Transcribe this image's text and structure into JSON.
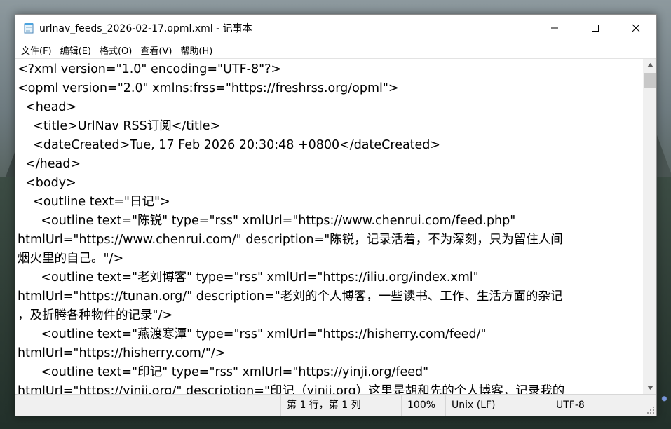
{
  "window": {
    "title": "urlnav_feeds_2026-02-17.opml.xml - 记事本",
    "minimize_glyph": "─",
    "maximize_glyph": "☐",
    "close_glyph": "✕"
  },
  "menubar": {
    "items": [
      {
        "label": "文件(F)"
      },
      {
        "label": "编辑(E)"
      },
      {
        "label": "格式(O)"
      },
      {
        "label": "查看(V)"
      },
      {
        "label": "帮助(H)"
      }
    ]
  },
  "document": {
    "lines": [
      "<?xml version=\"1.0\" encoding=\"UTF-8\"?>",
      "<opml version=\"2.0\" xmlns:frss=\"https://freshrss.org/opml\">",
      "  <head>",
      "    <title>UrlNav RSS订阅</title>",
      "    <dateCreated>Tue, 17 Feb 2026 20:30:48 +0800</dateCreated>",
      "  </head>",
      "  <body>",
      "    <outline text=\"日记\">",
      "      <outline text=\"陈锐\" type=\"rss\" xmlUrl=\"https://www.chenrui.com/feed.php\"",
      "htmlUrl=\"https://www.chenrui.com/\" description=\"陈锐，记录活着，不为深刻，只为留住人间",
      "烟火里的自己。\"/>",
      "      <outline text=\"老刘博客\" type=\"rss\" xmlUrl=\"https://iliu.org/index.xml\"",
      "htmlUrl=\"https://tunan.org/\" description=\"老刘的个人博客，一些读书、工作、生活方面的杂记",
      "，及折腾各种物件的记录\"/>",
      "      <outline text=\"燕渡寒潭\" type=\"rss\" xmlUrl=\"https://hisherry.com/feed/\"",
      "htmlUrl=\"https://hisherry.com/\"/>",
      "      <outline text=\"印记\" type=\"rss\" xmlUrl=\"https://yinji.org/feed\"",
      "htmlUrl=\"https://yinji.org/\" description=\"印记（yinji.org）这里是胡和先的个人博客，记录我的"
    ]
  },
  "statusbar": {
    "position": "第 1 行，第 1 列",
    "zoom": "100%",
    "line_ending": "Unix (LF)",
    "encoding": "UTF-8"
  }
}
